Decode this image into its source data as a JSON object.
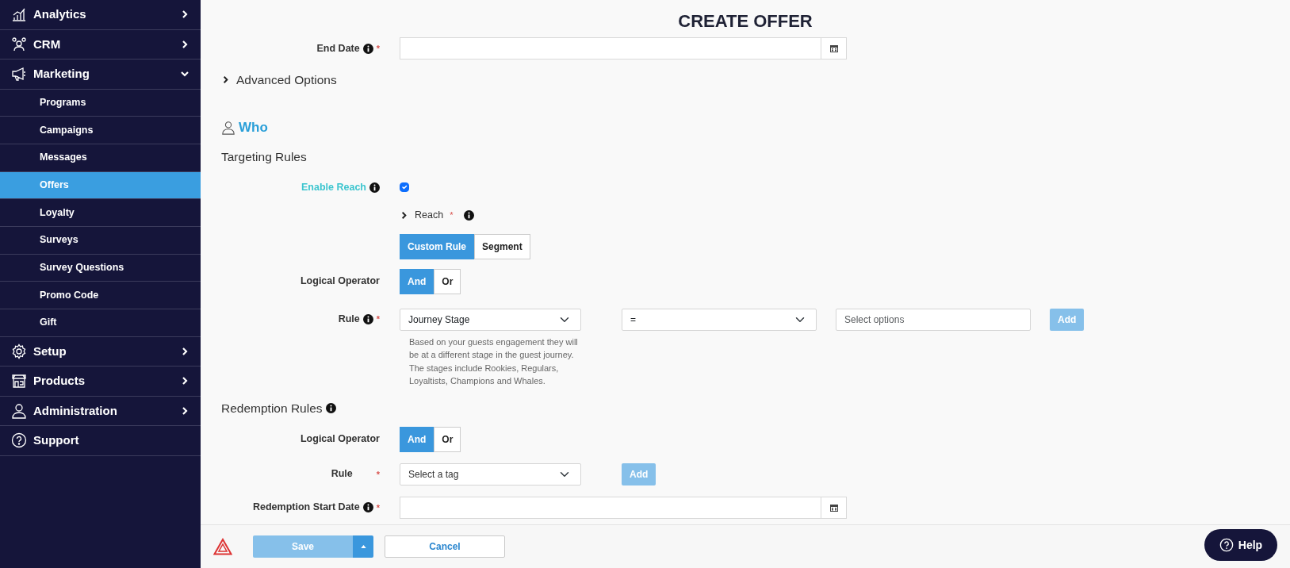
{
  "sidebar": {
    "items": [
      {
        "label": "Analytics",
        "expanded": false,
        "selected": false
      },
      {
        "label": "CRM",
        "expanded": false,
        "selected": false
      },
      {
        "label": "Marketing",
        "expanded": true,
        "selected": false,
        "children": [
          {
            "label": "Programs",
            "selected": false
          },
          {
            "label": "Campaigns",
            "selected": false
          },
          {
            "label": "Messages",
            "selected": false
          },
          {
            "label": "Offers",
            "selected": true
          },
          {
            "label": "Loyalty",
            "selected": false
          },
          {
            "label": "Surveys",
            "selected": false
          },
          {
            "label": "Survey Questions",
            "selected": false
          },
          {
            "label": "Promo Code",
            "selected": false
          },
          {
            "label": "Gift",
            "selected": false
          }
        ]
      },
      {
        "label": "Setup",
        "expanded": false,
        "selected": false
      },
      {
        "label": "Products",
        "expanded": false,
        "selected": false
      },
      {
        "label": "Administration",
        "expanded": false,
        "selected": false
      },
      {
        "label": "Support",
        "selected": false
      }
    ]
  },
  "page": {
    "title": "CREATE OFFER",
    "end_date": {
      "label": "End Date",
      "required_mark": "*"
    },
    "advanced_options": {
      "label": "Advanced Options",
      "expanded": false
    },
    "who": {
      "heading": "Who"
    },
    "targeting": {
      "heading": "Targeting Rules",
      "enable_reach": {
        "label": "Enable Reach",
        "checked": true
      },
      "reach": {
        "label": "Reach",
        "required_mark": "*",
        "expanded": false
      },
      "reach_mode": [
        {
          "label": "Custom Rule",
          "selected": true
        },
        {
          "label": "Segment",
          "selected": false
        }
      ],
      "logical_operator": {
        "label": "Logical Operator",
        "options": [
          {
            "label": "And",
            "selected": true
          },
          {
            "label": "Or",
            "selected": false
          }
        ]
      },
      "rule": {
        "label": "Rule",
        "required_mark": "*",
        "attribute": "Journey Stage",
        "operator": "=",
        "value_placeholder": "Select options",
        "add_button": {
          "label": "Add",
          "disabled": true
        },
        "help": "Based on your guests engagement they will be at a different stage in the guest journey. The stages include Rookies, Regulars, Loyaltists, Champions and Whales."
      }
    },
    "redemption": {
      "heading": "Redemption Rules",
      "logical_operator": {
        "label": "Logical Operator",
        "options": [
          {
            "label": "And",
            "selected": true
          },
          {
            "label": "Or",
            "selected": false
          }
        ]
      },
      "rule": {
        "label": "Rule",
        "required_mark": "*",
        "placeholder": "Select a tag",
        "add_button": {
          "label": "Add",
          "disabled": true
        }
      },
      "start_date": {
        "label": "Redemption Start Date",
        "required_mark": "*"
      }
    }
  },
  "footer": {
    "save": {
      "label": "Save",
      "disabled": true
    },
    "cancel": "Cancel",
    "help": "Help"
  }
}
